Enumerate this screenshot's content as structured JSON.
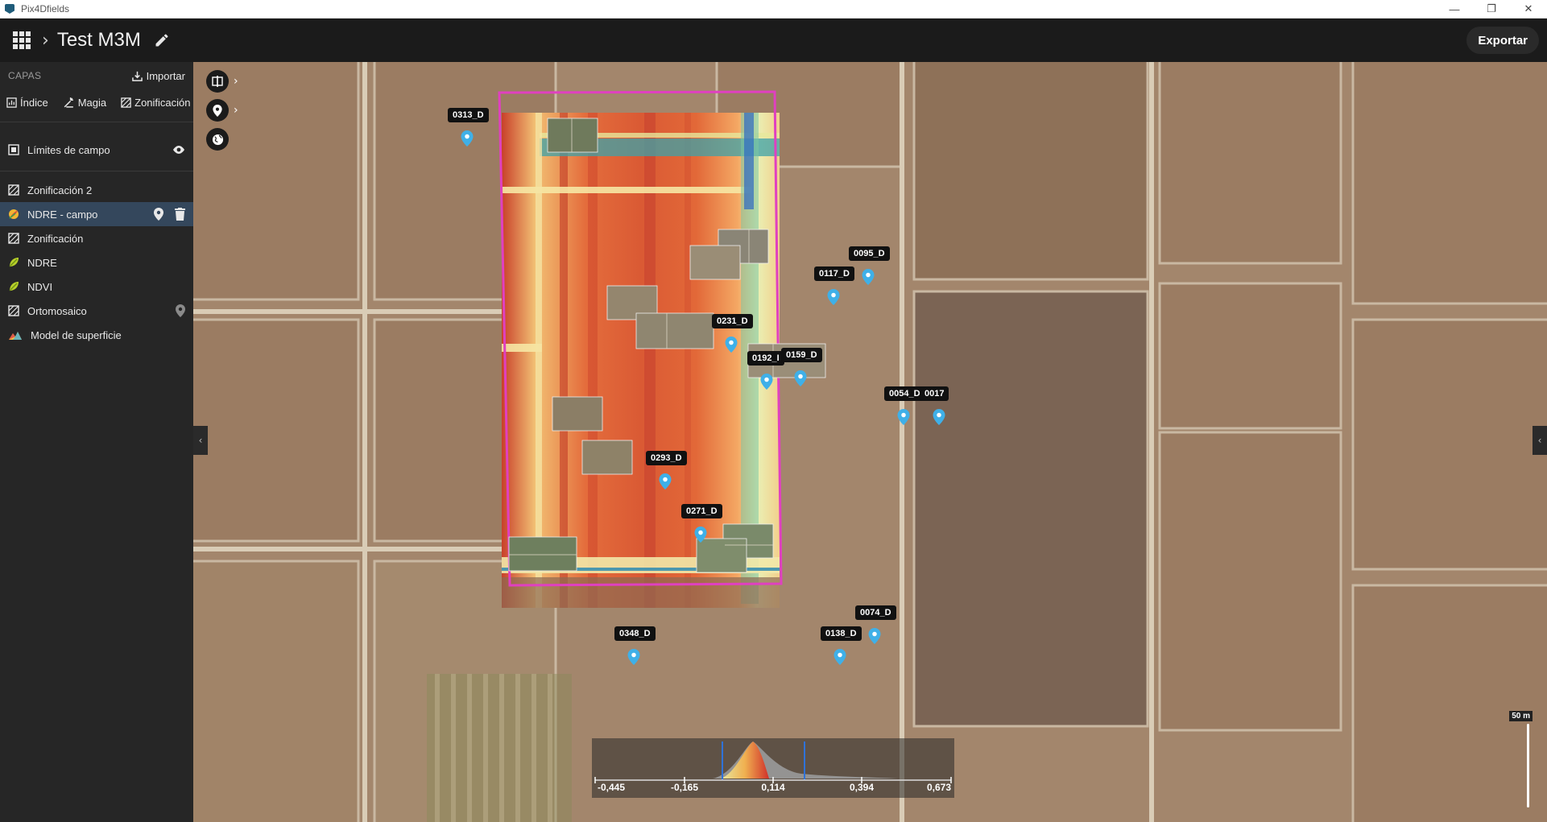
{
  "window": {
    "title": "Pix4Dfields"
  },
  "header": {
    "project_title": "Test M3M",
    "export_label": "Exportar"
  },
  "sidebar": {
    "section_title": "CAPAS",
    "import_label": "Importar",
    "tools": [
      {
        "label": "Índice",
        "icon": "index-icon"
      },
      {
        "label": "Magia",
        "icon": "magic-icon"
      },
      {
        "label": "Zonificación",
        "icon": "zoning-icon"
      }
    ],
    "boundary_layer": {
      "label": "Límites de campo",
      "icon": "boundary-icon"
    },
    "layers": [
      {
        "label": "Zonificación 2",
        "icon": "zoning-icon"
      },
      {
        "label": "NDRE - campo",
        "icon": "leaf-icon",
        "selected": true
      },
      {
        "label": "Zonificación",
        "icon": "zoning-icon"
      },
      {
        "label": "NDRE",
        "icon": "leaf-icon"
      },
      {
        "label": "NDVI",
        "icon": "leaf-icon"
      },
      {
        "label": "Ortomosaico",
        "icon": "zoning-icon"
      },
      {
        "label": "Model de superficie",
        "icon": "mountain-icon"
      }
    ]
  },
  "map": {
    "pins": [
      {
        "label": "0313_D"
      },
      {
        "label": "0095_D"
      },
      {
        "label": "0117_D"
      },
      {
        "label": "0231_D"
      },
      {
        "label": "0192_I"
      },
      {
        "label": "0159_D"
      },
      {
        "label": "0054_D"
      },
      {
        "label": "0017"
      },
      {
        "label": "0293_D"
      },
      {
        "label": "0271_D"
      },
      {
        "label": "0074_D"
      },
      {
        "label": "0348_D"
      },
      {
        "label": "0138_D"
      }
    ],
    "scale_label": "50 m",
    "legend_ticks": [
      "-0,445",
      "-0,165",
      "0,114",
      "0,394",
      "0,673"
    ],
    "field_outline_color": "#e040c0",
    "pin_color": "#3fb0e8"
  }
}
